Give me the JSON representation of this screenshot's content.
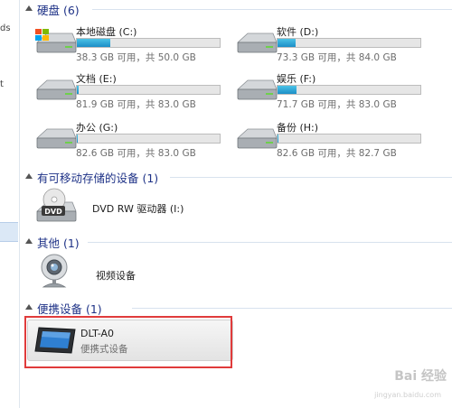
{
  "nav": {
    "fragments": [
      "ds",
      "t"
    ]
  },
  "groups": [
    {
      "id": "hard-disks",
      "title": "硬盘 (6)"
    },
    {
      "id": "removable",
      "title": "有可移动存储的设备 (1)"
    },
    {
      "id": "other",
      "title": "其他 (1)"
    },
    {
      "id": "portable",
      "title": "便携设备 (1)"
    }
  ],
  "drives": [
    {
      "name": "本地磁盘 (C:)",
      "size": "38.3 GB 可用，共 50.0 GB",
      "used_fraction": 0.234,
      "icon": "windows-drive-icon"
    },
    {
      "name": "软件 (D:)",
      "size": "73.3 GB 可用，共 84.0 GB",
      "used_fraction": 0.127,
      "icon": "hard-drive-icon"
    },
    {
      "name": "文档 (E:)",
      "size": "81.9 GB 可用，共 83.0 GB",
      "used_fraction": 0.013,
      "icon": "hard-drive-icon"
    },
    {
      "name": "娱乐 (F:)",
      "size": "71.7 GB 可用，共 83.0 GB",
      "used_fraction": 0.136,
      "icon": "hard-drive-icon"
    },
    {
      "name": "办公 (G:)",
      "size": "82.6 GB 可用，共 83.0 GB",
      "used_fraction": 0.005,
      "icon": "hard-drive-icon"
    },
    {
      "name": "备份 (H:)",
      "size": "82.6 GB 可用，共 82.7 GB",
      "used_fraction": 0.001,
      "icon": "hard-drive-icon"
    }
  ],
  "removable": {
    "name": "DVD RW 驱动器 (I:)",
    "icon": "dvd-drive-icon",
    "icon_label": "DVD"
  },
  "other": {
    "name": "视频设备",
    "icon": "webcam-icon"
  },
  "portable": {
    "name": "DLT-A0",
    "subtitle": "便携式设备",
    "icon": "portable-device-icon"
  },
  "watermark": {
    "text": "Bai 经验",
    "url": "jingyan.baidu.com"
  },
  "colors": {
    "bar_fill": "#26a0da",
    "group_title": "#1e3287",
    "highlight": "#e03b3b"
  }
}
